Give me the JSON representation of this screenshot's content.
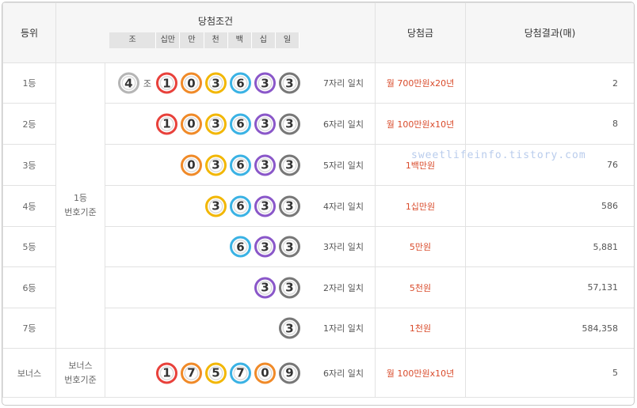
{
  "header": {
    "rank": "등위",
    "condition": "당첨조건",
    "units": [
      "조",
      "십만",
      "만",
      "천",
      "백",
      "십",
      "일"
    ],
    "prize": "당첨금",
    "result": "당첨결과(매)"
  },
  "unit_jo": "조",
  "basis_main": [
    "1등",
    "번호기준"
  ],
  "basis_bonus": [
    "보너스",
    "번호기준"
  ],
  "watermark": "sweetlifeinfo.tistory.com",
  "ball_colors": {
    "0": "#f08a28",
    "1": "#e8413b",
    "3": "#f2b705",
    "4": "#b5b5b5",
    "5": "#f2b705",
    "6": "#3ab2e4",
    "7": "#f08a28",
    "9": "#777777",
    "purple": "#8a57c9",
    "gray": "#777777"
  },
  "rows": [
    {
      "rank": "1등",
      "jo": "4",
      "digits": [
        "1",
        "0",
        "3",
        "6",
        "3",
        "3"
      ],
      "match": "7자리 일치",
      "prize": "월 700만원x20년",
      "count": "2"
    },
    {
      "rank": "2등",
      "digits": [
        "1",
        "0",
        "3",
        "6",
        "3",
        "3"
      ],
      "match": "6자리 일치",
      "prize": "월 100만원x10년",
      "count": "8"
    },
    {
      "rank": "3등",
      "digits": [
        "0",
        "3",
        "6",
        "3",
        "3"
      ],
      "match": "5자리 일치",
      "prize": "1백만원",
      "count": "76"
    },
    {
      "rank": "4등",
      "digits": [
        "3",
        "6",
        "3",
        "3"
      ],
      "match": "4자리 일치",
      "prize": "1십만원",
      "count": "586"
    },
    {
      "rank": "5등",
      "digits": [
        "6",
        "3",
        "3"
      ],
      "match": "3자리 일치",
      "prize": "5만원",
      "count": "5,881"
    },
    {
      "rank": "6등",
      "digits": [
        "3",
        "3"
      ],
      "match": "2자리 일치",
      "prize": "5천원",
      "count": "57,131"
    },
    {
      "rank": "7등",
      "digits": [
        "3"
      ],
      "match": "1자리 일치",
      "prize": "1천원",
      "count": "584,358"
    },
    {
      "rank": "보너스",
      "digits": [
        "1",
        "7",
        "5",
        "7",
        "0",
        "9"
      ],
      "match": "6자리 일치",
      "prize": "월 100만원x10년",
      "count": "5"
    }
  ]
}
